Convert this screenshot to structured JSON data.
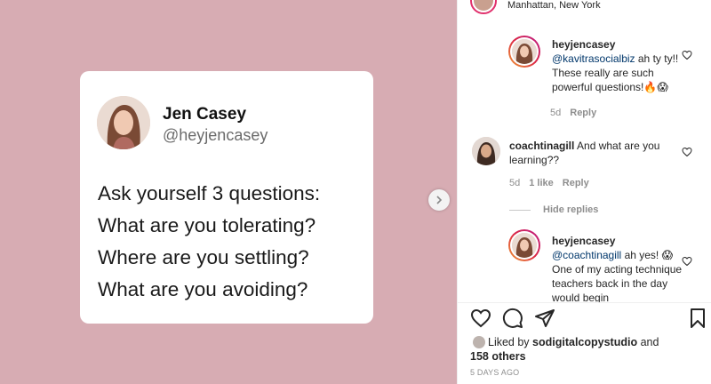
{
  "post_card": {
    "name": "Jen Casey",
    "handle": "@heyjencasey",
    "lines": [
      "Ask yourself 3 questions:",
      "What are you tolerating?",
      "Where are you settling?",
      "What are you avoiding?"
    ]
  },
  "header": {
    "location": "Manhattan, New York"
  },
  "comments": [
    {
      "username": "heyjencasey",
      "mention": "@kavitrasocialbiz",
      "text": " ah ty ty!! These really are such powerful questions!🔥😱",
      "age": "5d",
      "reply_label": "Reply"
    },
    {
      "username": "coachtinagill",
      "text": " And what are you learning??",
      "age": "5d",
      "likes": "1 like",
      "reply_label": "Reply"
    },
    {
      "username": "heyjencasey",
      "mention": "@coachtinagill",
      "text": " ah yes! 😱 One of my acting technique teachers back in the day would begin"
    }
  ],
  "hide_replies_label": "Hide replies",
  "likes": {
    "prefix": "Liked by ",
    "user": "sodigitalcopystudio",
    "middle": " and",
    "others": "158 others"
  },
  "timestamp": "5 DAYS AGO",
  "icons": {
    "next": "chevron-right-icon",
    "like": "heart-icon",
    "comment": "comment-bubble-icon",
    "share": "paper-plane-icon",
    "save": "bookmark-icon"
  }
}
